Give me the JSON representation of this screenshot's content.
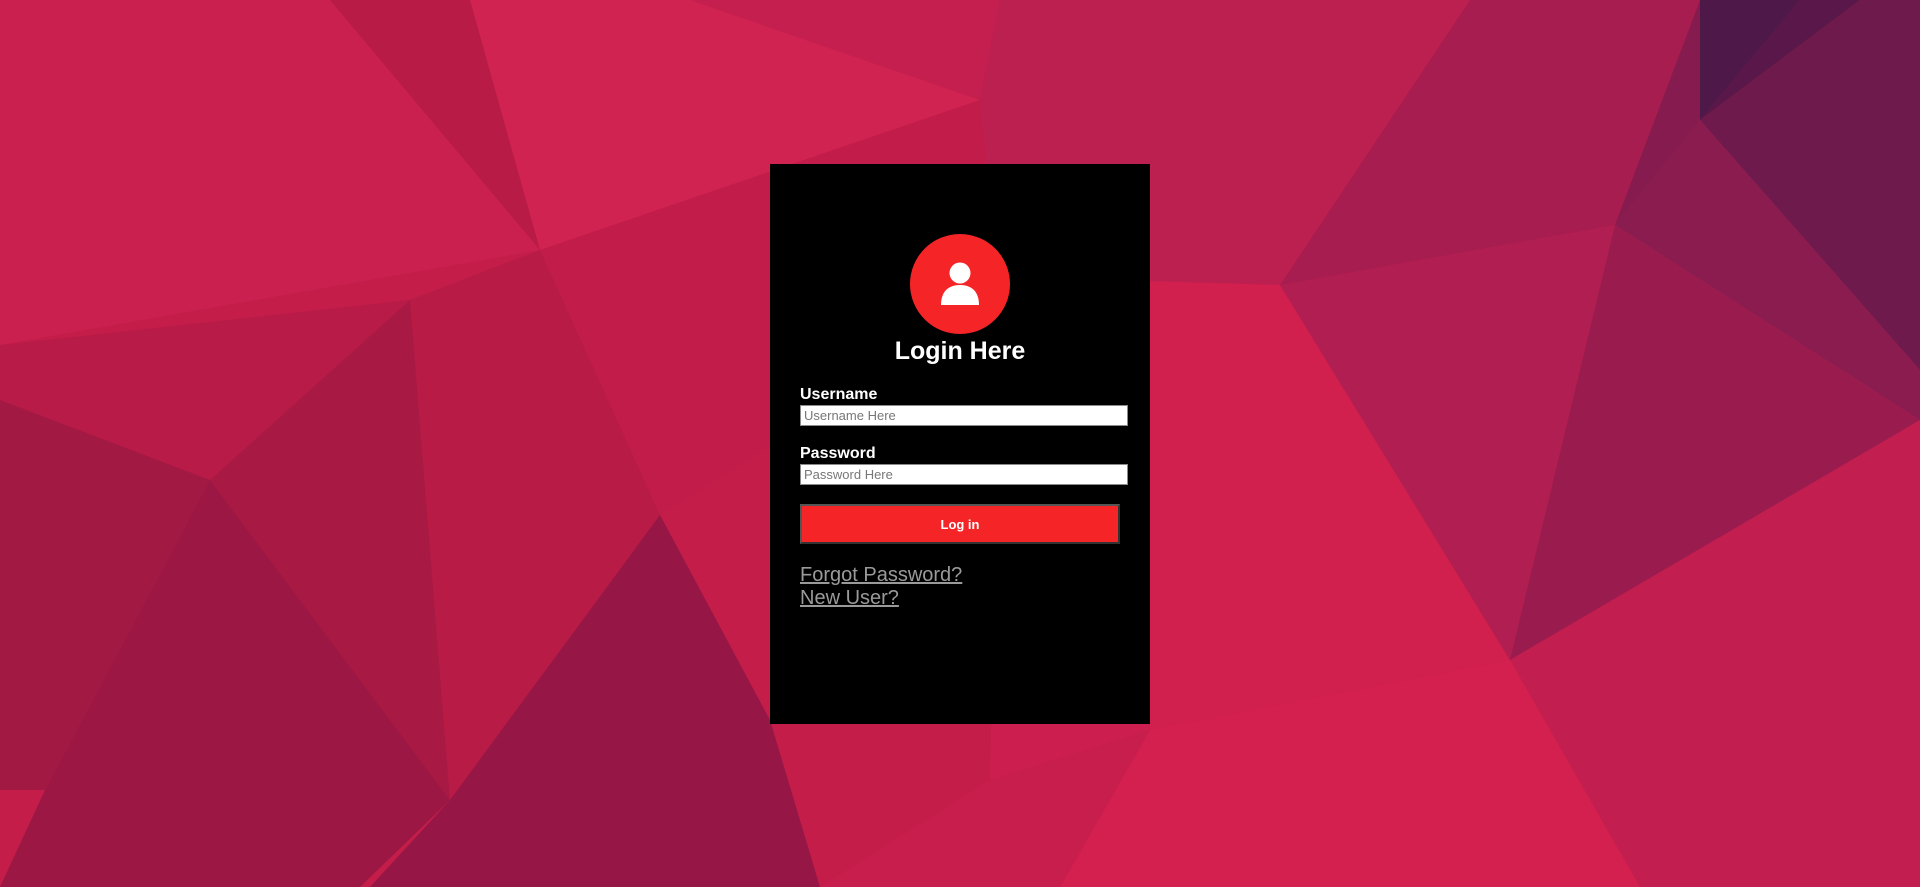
{
  "colors": {
    "accent": "#f52527",
    "panel": "#000000",
    "link": "#9a9a9a",
    "background_primary": "#c91e4c"
  },
  "login": {
    "avatar_icon": "user-icon",
    "title": "Login Here",
    "username_label": "Username",
    "username_placeholder": "Username Here",
    "username_value": "",
    "password_label": "Password",
    "password_placeholder": "Password Here",
    "password_value": "",
    "submit_label": "Log in",
    "forgot_link": "Forgot Password?",
    "new_user_link": "New User?"
  }
}
